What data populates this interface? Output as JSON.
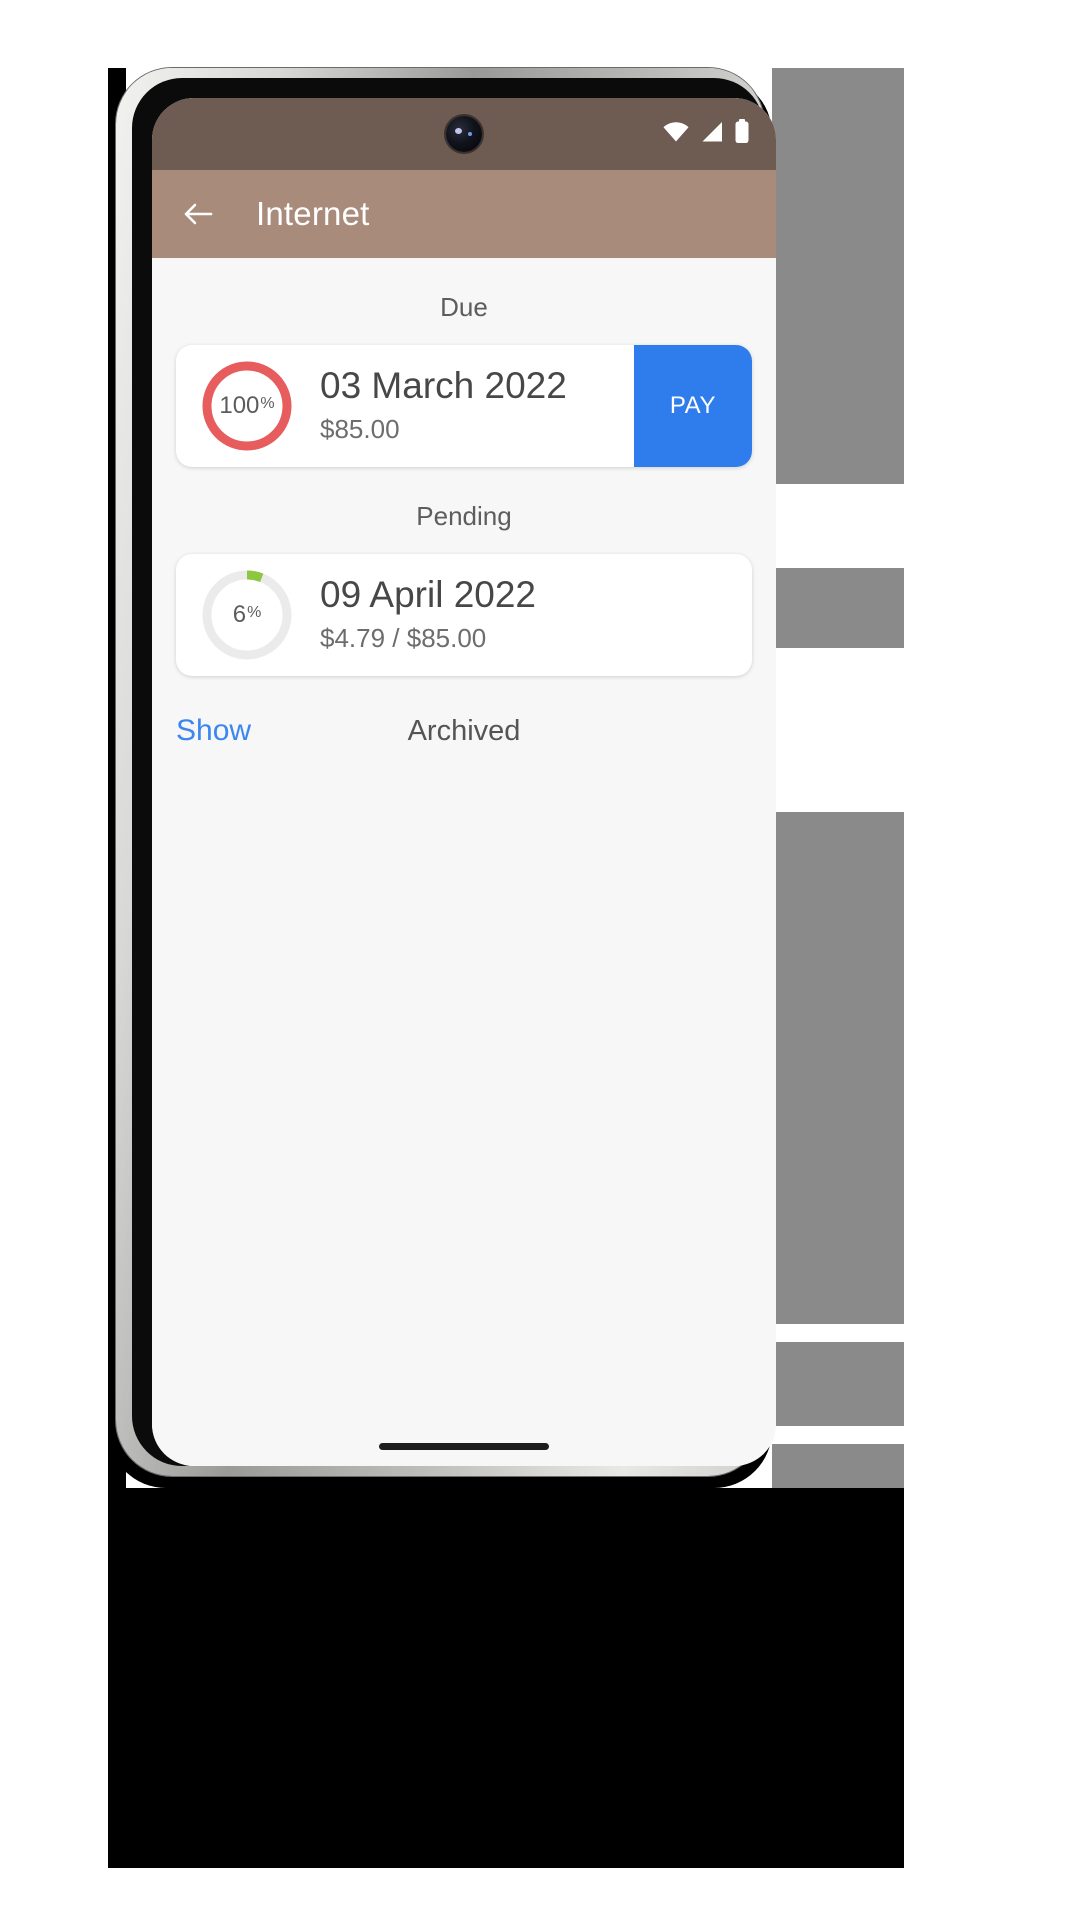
{
  "app": {
    "title": "Internet",
    "back_icon": "arrow-back-icon"
  },
  "status_bar": {
    "wifi_icon": "wifi-icon",
    "signal_icon": "cell-signal-icon",
    "battery_icon": "battery-icon",
    "background_color": "#6e5b52"
  },
  "theme": {
    "app_bar_color": "#a98b7c",
    "screen_background": "#f7f7f7",
    "accent_blue": "#2f7ded",
    "due_ring_color": "#e75c5c",
    "pending_ring_color": "#8dc63f",
    "ring_track_color": "#ebebeb"
  },
  "sections": [
    {
      "header": "Due",
      "card": {
        "percent_value": "100",
        "percent_sign": "%",
        "percent_number": 100,
        "ring_color": "#e75c5c",
        "date": "03 March 2022",
        "amount": "$85.00",
        "action_label": "PAY",
        "has_action": true
      }
    },
    {
      "header": "Pending",
      "card": {
        "percent_value": "6",
        "percent_sign": "%",
        "percent_number": 6,
        "ring_color": "#8dc63f",
        "date": "09 April 2022",
        "amount": "$4.79 / $85.00",
        "action_label": "",
        "has_action": false
      }
    }
  ],
  "bottom_row": {
    "show_link": "Show",
    "archived_label": "Archived"
  }
}
